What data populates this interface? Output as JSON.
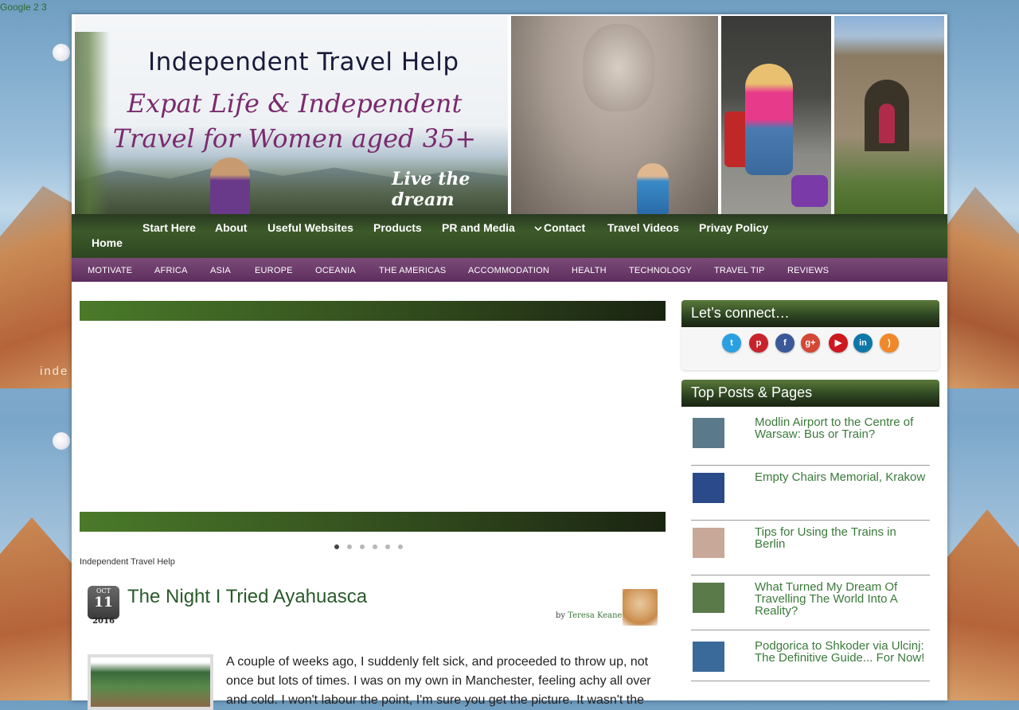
{
  "top_links": "Google 2 3",
  "background_word": "inde",
  "header": {
    "title": "Independent Travel Help",
    "subtitle": "Expat Life & Independent Travel for Women aged 35+",
    "tagline": "Live the dream"
  },
  "nav": {
    "items": [
      "Start Here",
      "About",
      "Useful Websites",
      "Products",
      "PR and Media",
      "Contact",
      "Travel Videos",
      "Privay Policy"
    ],
    "home": "Home",
    "contact_icon": "chevron-down-icon"
  },
  "categories": [
    "MOTIVATE",
    "AFRICA",
    "ASIA",
    "EUROPE",
    "OCEANIA",
    "THE AMERICAS",
    "ACCOMMODATION",
    "HEALTH",
    "TECHNOLOGY",
    "TRAVEL TIP",
    "REVIEWS"
  ],
  "slider": {
    "slide_count": 6,
    "active_index": 0,
    "site_label": "Independent Travel Help"
  },
  "post": {
    "date": {
      "month": "OCT",
      "day": "11",
      "year": "2016"
    },
    "title": "The Night I Tried Ayahuasca",
    "by": "by",
    "author": "Teresa Keane",
    "body": "A couple of weeks ago, I suddenly felt sick, and proceeded to throw up, not once but lots of times.  I was on my own in Manchester, feeling achy all over and cold.  I won't labour the point, I'm sure you get the picture.  It wasn't the"
  },
  "connect_widget": {
    "title": "Let’s connect…",
    "icons": [
      {
        "name": "twitter-icon",
        "glyph": "t",
        "color": "#2aa0e0"
      },
      {
        "name": "pinterest-icon",
        "glyph": "p",
        "color": "#c8232c"
      },
      {
        "name": "facebook-icon",
        "glyph": "f",
        "color": "#3b5998"
      },
      {
        "name": "google-plus-icon",
        "glyph": "g+",
        "color": "#d34836"
      },
      {
        "name": "youtube-icon",
        "glyph": "▶",
        "color": "#cc181e"
      },
      {
        "name": "linkedin-icon",
        "glyph": "in",
        "color": "#0e76a8"
      },
      {
        "name": "rss-icon",
        "glyph": ")",
        "color": "#f0882a"
      }
    ]
  },
  "top_posts": {
    "title": "Top Posts & Pages",
    "items": [
      {
        "title": "Modlin Airport to the Centre of Warsaw: Bus or Train?",
        "thumb_color": "#5a7a8a"
      },
      {
        "title": "Empty Chairs Memorial, Krakow",
        "thumb_color": "#2a4a8a"
      },
      {
        "title": "Tips for Using the Trains in Berlin",
        "thumb_color": "#c8a898"
      },
      {
        "title": "What Turned My Dream Of Travelling The World Into A Reality?",
        "thumb_color": "#5a7a4a"
      },
      {
        "title": "Podgorica to Shkoder via Ulcinj: The Definitive Guide... For Now!",
        "thumb_color": "#3a6a9a"
      }
    ]
  }
}
